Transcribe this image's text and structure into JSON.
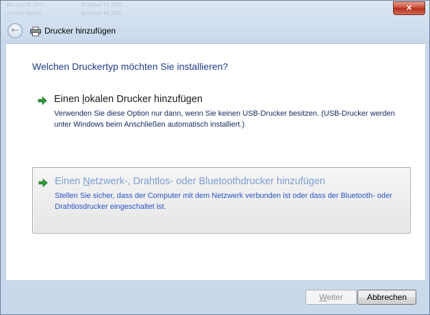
{
  "window": {
    "title_ghost": [
      "Microsoft XPS",
      "Brother HL208",
      "ument Writer",
      "Brother HL208"
    ],
    "close_label": "×"
  },
  "nav": {
    "back_icon": "back-arrow-icon",
    "printer_icon": "printer-icon",
    "title": "Drucker hinzufügen"
  },
  "main": {
    "heading": "Welchen Druckertyp möchten Sie installieren?",
    "options": [
      {
        "title_before": "Einen ",
        "title_accel": "l",
        "title_after": "okalen Drucker hinzufügen",
        "description": "Verwenden Sie diese Option nur dann, wenn Sie keinen USB-Drucker besitzen. (USB-Drucker werden unter Windows beim Anschließen automatisch installiert.)",
        "icon": "green-arrow-icon"
      },
      {
        "title_before": "Einen ",
        "title_accel": "N",
        "title_after": "etzwerk-, Drahtlos- oder Bluetoothdrucker hinzufügen",
        "description": "Stellen Sie sicher, dass der Computer mit dem Netzwerk verbunden ist oder dass der Bluetooth- oder Drahtlosdrucker eingeschaltet ist.",
        "icon": "green-arrow-icon"
      }
    ]
  },
  "footer": {
    "next_accel": "W",
    "next_rest": "eiter",
    "cancel_label": "Abbrechen"
  },
  "colors": {
    "heading": "#1e3b8a",
    "hover_title": "#7b9ed0",
    "hover_desc": "#2a55c6",
    "arrow_green": "#2f9e3a"
  }
}
